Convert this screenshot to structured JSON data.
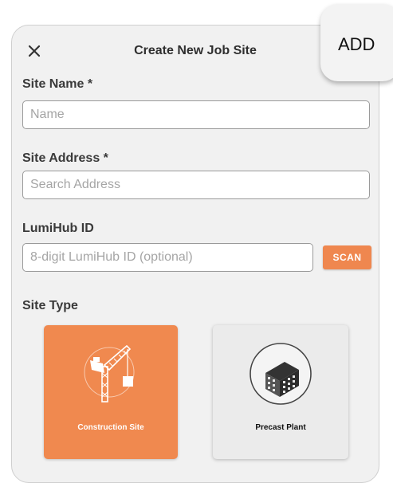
{
  "header": {
    "title": "Create New Job Site",
    "close_icon": "close-icon",
    "add_label": "ADD"
  },
  "form": {
    "site_name": {
      "label": "Site Name *",
      "value": "",
      "placeholder": "Name"
    },
    "site_address": {
      "label": "Site Address *",
      "value": "",
      "placeholder": "Search Address"
    },
    "lumihub_id": {
      "label": "LumiHub ID",
      "value": "",
      "placeholder": "8-digit LumiHub ID (optional)",
      "scan_label": "SCAN"
    },
    "site_type": {
      "label": "Site Type",
      "options": [
        {
          "label": "Construction Site",
          "icon": "crane-icon",
          "selected": true
        },
        {
          "label": "Precast Plant",
          "icon": "precast-slab-icon",
          "selected": false
        }
      ]
    }
  },
  "colors": {
    "accent": "#f0894f",
    "background": "#f1f1f1",
    "card_unselected": "#ebebeb"
  }
}
